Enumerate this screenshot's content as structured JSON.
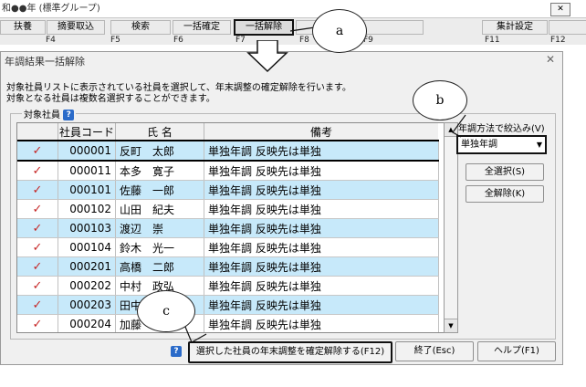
{
  "app": {
    "title": "和●●年 (標準グループ)",
    "window_close": "✕",
    "toolbar": [
      {
        "label": "扶養",
        "fkey": ""
      },
      {
        "label": "摘要取込",
        "fkey": "F4"
      },
      {
        "label": "検索",
        "fkey": "F5"
      },
      {
        "label": "一括確定",
        "fkey": "F6"
      },
      {
        "label": "一括解除",
        "fkey": "F7"
      },
      {
        "label": "",
        "fkey": "F8"
      },
      {
        "label": "",
        "fkey": "F9"
      },
      {
        "label": "集計設定",
        "fkey": "F11"
      },
      {
        "label": "",
        "fkey": "F12"
      }
    ]
  },
  "callouts": {
    "a": "a",
    "b": "b",
    "c": "c"
  },
  "dialog": {
    "title": "年調結果一括解除",
    "close": "✕",
    "description_line1": "対象社員リストに表示されている社員を選択して、年末調整の確定解除を行います。",
    "description_line2": "対象となる社員は複数名選択することができます。",
    "group_label": "対象社員",
    "help_icon": "?",
    "table": {
      "headers": [
        "",
        "社員コード",
        "氏 名",
        "備考"
      ],
      "rows": [
        {
          "check": "✓",
          "code": "000001",
          "name": "反町　太郎",
          "note": "単独年調 反映先は単独"
        },
        {
          "check": "✓",
          "code": "000011",
          "name": "本多　寛子",
          "note": "単独年調 反映先は単独"
        },
        {
          "check": "✓",
          "code": "000101",
          "name": "佐藤　一郎",
          "note": "単独年調 反映先は単独"
        },
        {
          "check": "✓",
          "code": "000102",
          "name": "山田　紀夫",
          "note": "単独年調 反映先は単独"
        },
        {
          "check": "✓",
          "code": "000103",
          "name": "渡辺　崇",
          "note": "単独年調 反映先は単独"
        },
        {
          "check": "✓",
          "code": "000104",
          "name": "鈴木　光一",
          "note": "単独年調 反映先は単独"
        },
        {
          "check": "✓",
          "code": "000201",
          "name": "高橋　二郎",
          "note": "単独年調 反映先は単独"
        },
        {
          "check": "✓",
          "code": "000202",
          "name": "中村　政弘",
          "note": "単独年調 反映先は単独"
        },
        {
          "check": "✓",
          "code": "000203",
          "name": "田中",
          "note": "単独年調 反映先は単独"
        },
        {
          "check": "✓",
          "code": "000204",
          "name": "加藤",
          "note": "単独年調 反映先は単独"
        }
      ]
    },
    "filter": {
      "label": "年調方法で絞込み(V)",
      "value": "単独年調"
    },
    "select_all": "全選択(S)",
    "deselect_all": "全解除(K)",
    "execute": "選択した社員の年末調整を確定解除する(F12)",
    "exit": "終了(Esc)",
    "help": "ヘルプ(F1)"
  }
}
